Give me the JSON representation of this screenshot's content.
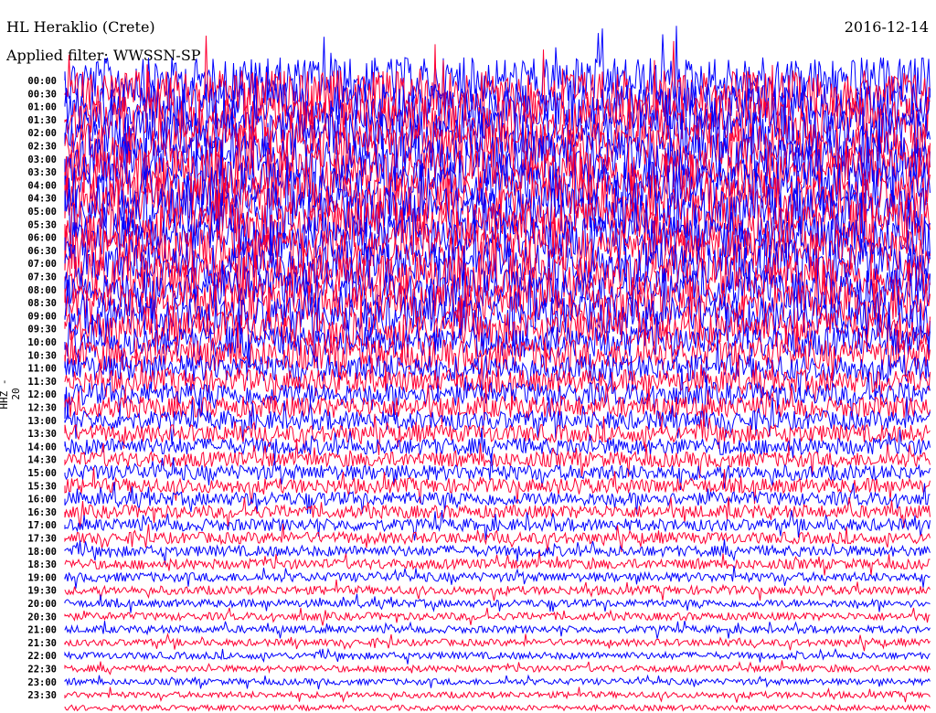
{
  "header": {
    "station": "HL Heraklio (Crete)",
    "date": "2016-12-14",
    "filter": "Applied filter: WWSSN-SP"
  },
  "chart_data": {
    "type": "line",
    "title": "HL Heraklio (Crete)",
    "subtitle": "Applied filter: WWSSN-SP",
    "ylabel": "HHZ - 20",
    "xlabel": "",
    "row_labels": [
      "00:00",
      "00:30",
      "01:00",
      "01:30",
      "02:00",
      "02:30",
      "03:00",
      "03:30",
      "04:00",
      "04:30",
      "05:00",
      "05:30",
      "06:00",
      "06:30",
      "07:00",
      "07:30",
      "08:00",
      "08:30",
      "09:00",
      "09:30",
      "10:00",
      "10:30",
      "11:00",
      "11:30",
      "12:00",
      "12:30",
      "13:00",
      "13:30",
      "14:00",
      "14:30",
      "15:00",
      "15:30",
      "16:00",
      "16:30",
      "17:00",
      "17:30",
      "18:00",
      "18:30",
      "19:00",
      "19:30",
      "20:00",
      "20:30",
      "21:00",
      "21:30",
      "22:00",
      "22:30",
      "23:00",
      "23:30"
    ],
    "minutes_per_row": 30,
    "relative_amplitude_by_row": [
      6,
      6,
      6,
      6,
      6,
      6,
      6,
      6,
      6,
      6,
      6,
      6,
      5.5,
      5.5,
      5.5,
      5.5,
      5,
      5,
      5,
      4.5,
      4,
      4,
      3.5,
      3,
      3,
      2.8,
      2.5,
      2.3,
      2.2,
      2,
      2,
      1.9,
      1.8,
      1.7,
      1.6,
      1.5,
      1.4,
      1.3,
      1.2,
      1.1,
      1,
      1,
      0.95,
      0.9,
      0.9,
      0.85,
      0.8,
      0.8
    ],
    "series_colors": [
      "#0000ff",
      "#ff0033"
    ]
  }
}
